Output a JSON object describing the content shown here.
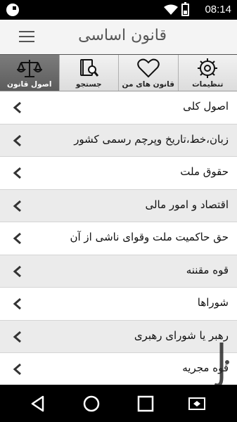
{
  "status_bar": {
    "time": "08:14",
    "icons": [
      "app-notification-icon",
      "wifi-icon",
      "battery-icon"
    ]
  },
  "app_bar": {
    "title": "قانون اساسی",
    "menu_icon": "hamburger-menu-icon"
  },
  "tabs": [
    {
      "label": "اصول قانون",
      "icon": "scales-icon",
      "active": true
    },
    {
      "label": "جستجو",
      "icon": "book-search-icon",
      "active": false
    },
    {
      "label": "قانون های من",
      "icon": "heart-icon",
      "active": false
    },
    {
      "label": "تنظیمات",
      "icon": "gear-icon",
      "active": false
    }
  ],
  "list": {
    "items": [
      {
        "label": "اصول کلی"
      },
      {
        "label": "زبان،خط،تاریخ وپرچم رسمی کشور"
      },
      {
        "label": "حقوق ملت"
      },
      {
        "label": "اقتصاد و امور مالی"
      },
      {
        "label": "حق حاکمیت ملت وقوای ناشی از آن"
      },
      {
        "label": "قوه مقننه"
      },
      {
        "label": "شوراها"
      },
      {
        "label": "رهبر یا شورای رهبری"
      },
      {
        "label": "قوه مجریه"
      }
    ]
  },
  "colors": {
    "app_bar_bg": "#f4f4f4",
    "active_tab_bg": "#6c6c6c",
    "alt_row_bg": "#ebebeb",
    "text": "#111111"
  },
  "nav_bar": {
    "buttons": [
      "back-icon",
      "home-icon",
      "recents-icon",
      "screen-mirror-icon"
    ]
  }
}
